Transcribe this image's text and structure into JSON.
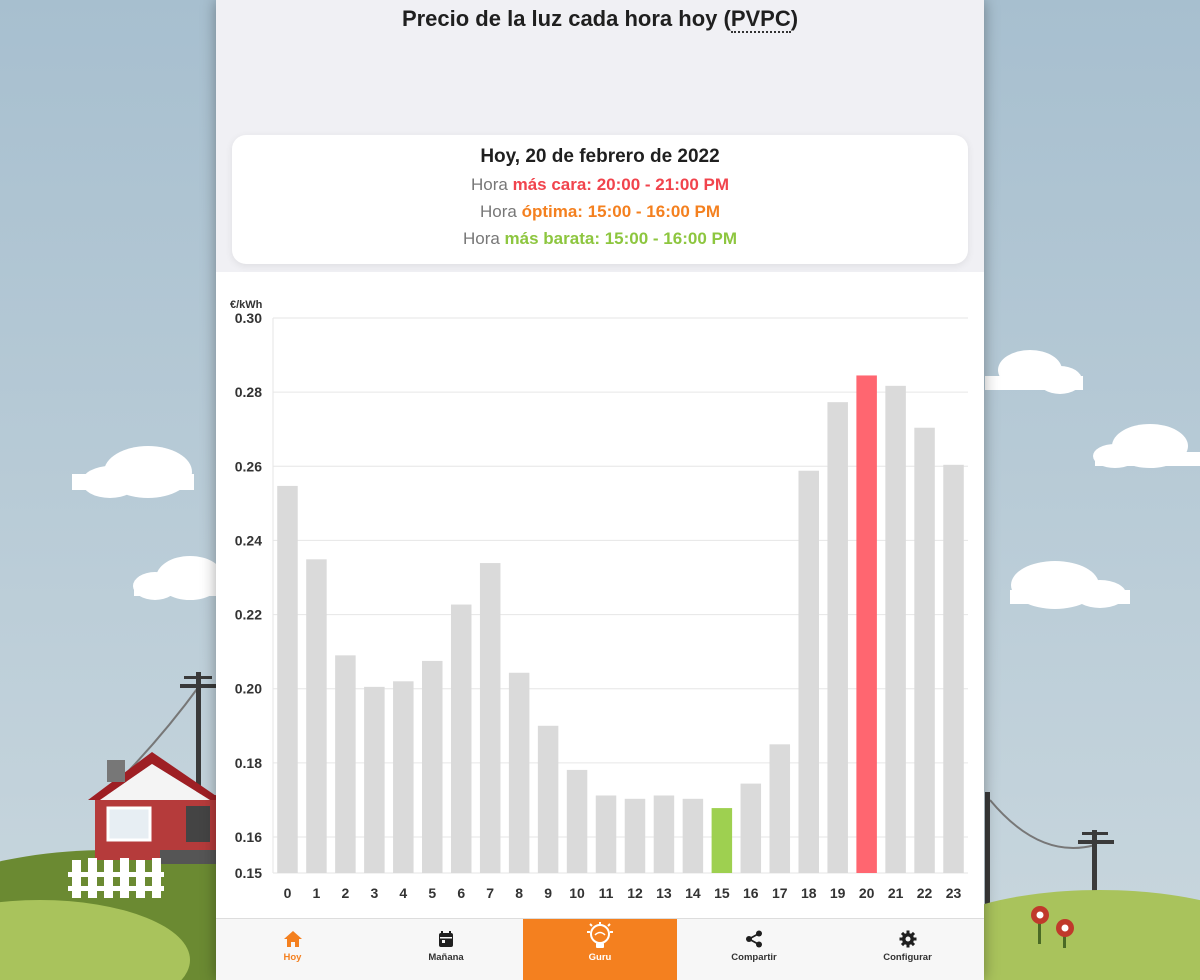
{
  "page": {
    "title_prefix": "Precio de la luz cada hora hoy (",
    "title_abbr": "PVPC",
    "title_suffix": ")"
  },
  "summary": {
    "date": "Hoy, 20 de febrero de 2022",
    "rows": [
      {
        "prefix": "Hora ",
        "label": "más cara:",
        "value": "20:00 - 21:00 PM",
        "color": "#f1444d"
      },
      {
        "prefix": "Hora ",
        "label": "óptima:",
        "value": "15:00 - 16:00 PM",
        "color": "#f4801f"
      },
      {
        "prefix": "Hora ",
        "label": "más barata:",
        "value": "15:00 - 16:00 PM",
        "color": "#8dc63f"
      }
    ]
  },
  "chart_data": {
    "type": "bar",
    "ylabel": "€/kWh",
    "ylim": [
      0.15,
      0.3
    ],
    "yticks": [
      "0.15",
      "0.16",
      "0.18",
      "0.20",
      "0.22",
      "0.24",
      "0.26",
      "0.28",
      "0.30"
    ],
    "grid": true,
    "categories": [
      "0",
      "1",
      "2",
      "3",
      "4",
      "5",
      "6",
      "7",
      "8",
      "9",
      "10",
      "11",
      "12",
      "13",
      "14",
      "15",
      "16",
      "17",
      "18",
      "19",
      "20",
      "21",
      "22",
      "23"
    ],
    "values": [
      0.2547,
      0.2349,
      0.209,
      0.2005,
      0.202,
      0.2075,
      0.2227,
      0.2339,
      0.2043,
      0.19,
      0.1781,
      0.1712,
      0.1703,
      0.1712,
      0.1703,
      0.1678,
      0.1744,
      0.185,
      0.2588,
      0.2773,
      0.2845,
      0.2817,
      0.2704,
      0.2604
    ],
    "highlight": {
      "max_index": 20,
      "max_color": "#ff6670",
      "min_index": 15,
      "min_color": "#9ed050"
    },
    "bar_color": "#dadada"
  },
  "nav": [
    {
      "label": "Hoy",
      "icon": "home-icon"
    },
    {
      "label": "Mañana",
      "icon": "calendar-icon"
    },
    {
      "label": "Guru",
      "icon": "lightbulb-icon"
    },
    {
      "label": "Compartir",
      "icon": "share-icon"
    },
    {
      "label": "Configurar",
      "icon": "gear-icon"
    }
  ],
  "colors": {
    "accent": "#f4801f",
    "expensive": "#f1444d",
    "cheap": "#8dc63f",
    "sky": "#b4c9d6",
    "grass": "#6e8f34"
  }
}
